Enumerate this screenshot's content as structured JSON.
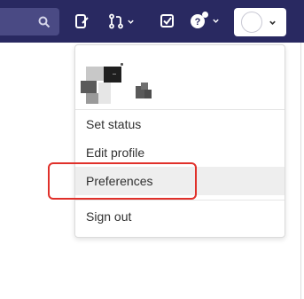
{
  "colors": {
    "navbar": "#292961",
    "highlight": "#e0302a",
    "hover": "#eeeeee"
  },
  "navbar": {
    "search_icon": "search-icon",
    "icons": [
      "todo-review-icon",
      "merge-request-icon",
      "issues-check-icon",
      "help-icon"
    ]
  },
  "user_menu": {
    "avatar_icon": "user-avatar-icon",
    "items": [
      {
        "label": "Set status"
      },
      {
        "label": "Edit profile"
      },
      {
        "label": "Preferences"
      },
      {
        "label": "Sign out"
      }
    ]
  }
}
